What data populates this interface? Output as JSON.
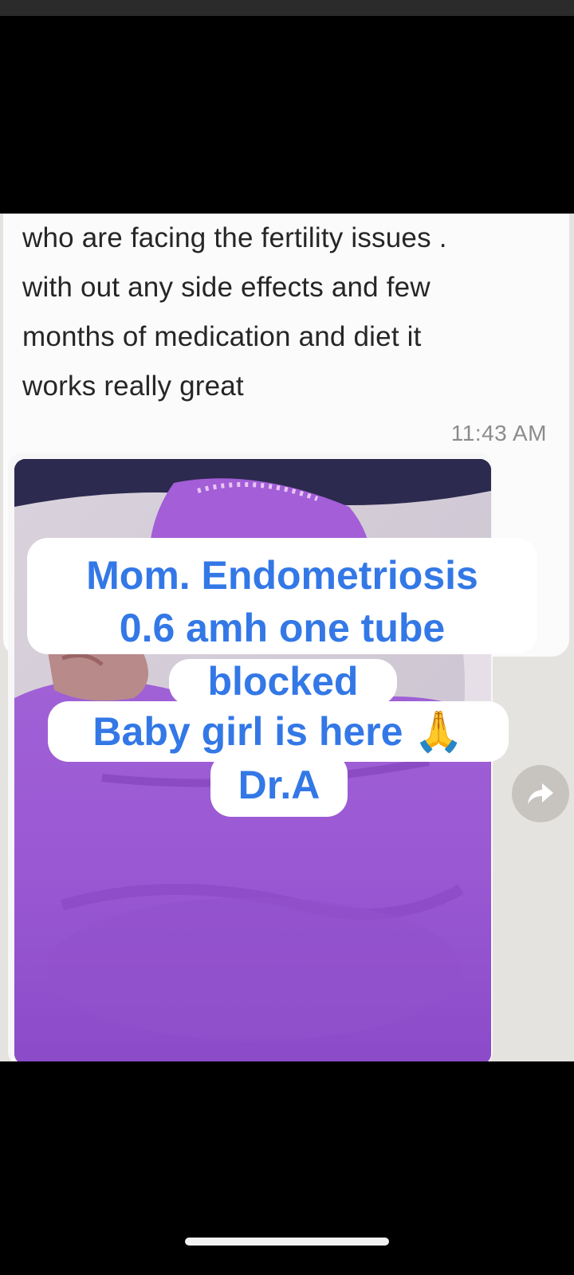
{
  "message": {
    "text": "who are facing the fertility issues .\nwith out any side effects and few\nmonths of medication and diet it\nworks really great",
    "time": "11:43 AM"
  },
  "media": {
    "icon": "photo-of-newborn-in-purple-blanket"
  },
  "forward": {
    "icon": "forward-arrow-icon"
  },
  "overlay": {
    "line1": "Mom. Endometriosis",
    "line2": "0.6 amh one tube",
    "line3": "blocked",
    "line4": "Baby girl is here 🙏",
    "line5": "Dr.A",
    "color": "#3378e6"
  }
}
